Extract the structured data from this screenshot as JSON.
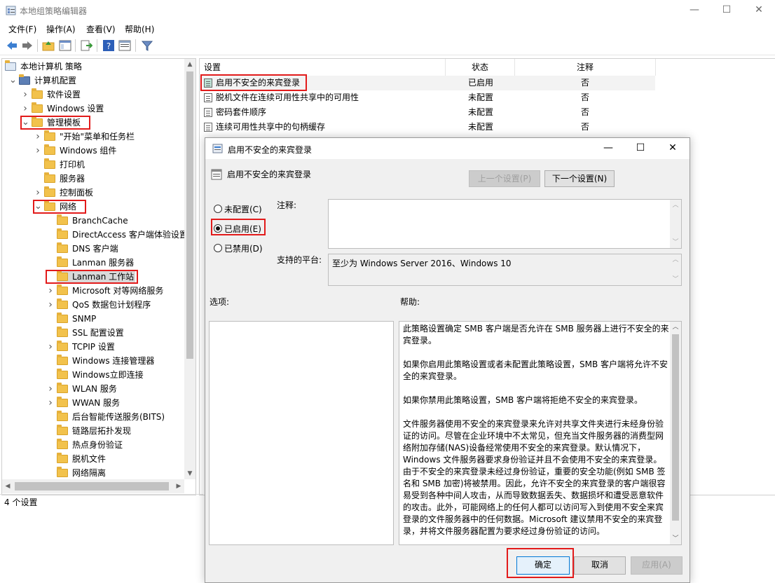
{
  "window": {
    "title": "本地组策略编辑器",
    "menu": [
      "文件(F)",
      "操作(A)",
      "查看(V)",
      "帮助(H)"
    ]
  },
  "tree": {
    "items": [
      {
        "label": "本地计算机 策略",
        "level": 0,
        "toggle": ""
      },
      {
        "label": "计算机配置",
        "level": 1,
        "toggle": "open"
      },
      {
        "label": "软件设置",
        "level": 2,
        "toggle": "closed"
      },
      {
        "label": "Windows 设置",
        "level": 2,
        "toggle": "closed"
      },
      {
        "label": "管理模板",
        "level": 2,
        "toggle": "open",
        "highlight": true
      },
      {
        "label": "\"开始\"菜单和任务栏",
        "level": 3,
        "toggle": "closed"
      },
      {
        "label": "Windows 组件",
        "level": 3,
        "toggle": "closed"
      },
      {
        "label": "打印机",
        "level": 3,
        "toggle": ""
      },
      {
        "label": "服务器",
        "level": 3,
        "toggle": ""
      },
      {
        "label": "控制面板",
        "level": 3,
        "toggle": "closed"
      },
      {
        "label": "网络",
        "level": 3,
        "toggle": "open",
        "highlight": true
      },
      {
        "label": "BranchCache",
        "level": 4,
        "toggle": ""
      },
      {
        "label": "DirectAccess 客户端体验设置",
        "level": 4,
        "toggle": ""
      },
      {
        "label": "DNS 客户端",
        "level": 4,
        "toggle": ""
      },
      {
        "label": "Lanman 服务器",
        "level": 4,
        "toggle": ""
      },
      {
        "label": "Lanman 工作站",
        "level": 4,
        "toggle": "",
        "highlight": true,
        "selected": true
      },
      {
        "label": "Microsoft 对等网络服务",
        "level": 4,
        "toggle": "closed"
      },
      {
        "label": "QoS 数据包计划程序",
        "level": 4,
        "toggle": "closed"
      },
      {
        "label": "SNMP",
        "level": 4,
        "toggle": ""
      },
      {
        "label": "SSL 配置设置",
        "level": 4,
        "toggle": ""
      },
      {
        "label": "TCPIP 设置",
        "level": 4,
        "toggle": "closed"
      },
      {
        "label": "Windows 连接管理器",
        "level": 4,
        "toggle": ""
      },
      {
        "label": "Windows立即连接",
        "level": 4,
        "toggle": ""
      },
      {
        "label": "WLAN 服务",
        "level": 4,
        "toggle": "closed"
      },
      {
        "label": "WWAN 服务",
        "level": 4,
        "toggle": "closed"
      },
      {
        "label": "后台智能传送服务(BITS)",
        "level": 4,
        "toggle": ""
      },
      {
        "label": "链路层拓扑发现",
        "level": 4,
        "toggle": ""
      },
      {
        "label": "热点身份验证",
        "level": 4,
        "toggle": ""
      },
      {
        "label": "脱机文件",
        "level": 4,
        "toggle": ""
      },
      {
        "label": "网络隔离",
        "level": 4,
        "toggle": ""
      }
    ]
  },
  "list": {
    "columns": [
      "设置",
      "状态",
      "注释"
    ],
    "rows": [
      {
        "name": "启用不安全的来宾登录",
        "state": "已启用",
        "note": "否",
        "highlight": true
      },
      {
        "name": "脱机文件在连续可用性共享中的可用性",
        "state": "未配置",
        "note": "否"
      },
      {
        "name": "密码套件顺序",
        "state": "未配置",
        "note": "否"
      },
      {
        "name": "连续可用性共享中的句柄缓存",
        "state": "未配置",
        "note": "否"
      }
    ]
  },
  "status": "4 个设置",
  "dialog": {
    "title": "启用不安全的来宾登录",
    "header": "启用不安全的来宾登录",
    "prev_button": "上一个设置(P)",
    "next_button": "下一个设置(N)",
    "radios": [
      {
        "label": "未配置(C)",
        "checked": false
      },
      {
        "label": "已启用(E)",
        "checked": true
      },
      {
        "label": "已禁用(D)",
        "checked": false
      }
    ],
    "comment_label": "注释:",
    "platform_label": "支持的平台:",
    "platform_value": "至少为 Windows Server 2016、Windows 10",
    "options_label": "选项:",
    "help_label": "帮助:",
    "help_paragraphs": [
      "此策略设置确定 SMB 客户端是否允许在 SMB 服务器上进行不安全的来宾登录。",
      "如果你启用此策略设置或者未配置此策略设置，SMB 客户端将允许不安全的来宾登录。",
      "如果你禁用此策略设置，SMB 客户端将拒绝不安全的来宾登录。",
      "文件服务器使用不安全的来宾登录来允许对共享文件夹进行未经身份验证的访问。尽管在企业环境中不太常见，但充当文件服务器的消费型网络附加存储(NAS)设备经常使用不安全的来宾登录。默认情况下，Windows 文件服务器要求身份验证并且不会使用不安全的来宾登录。由于不安全的来宾登录未经过身份验证，重要的安全功能(例如 SMB 签名和 SMB 加密)将被禁用。因此，允许不安全的来宾登录的客户端很容易受到各种中间人攻击，从而导致数据丢失、数据损坏和遭受恶意软件的攻击。此外，可能网络上的任何人都可以访问写入到使用不安全来宾登录的文件服务器中的任何数据。Microsoft 建议禁用不安全的来宾登录，并将文件服务器配置为要求经过身份验证的访问。"
    ],
    "ok_button": "确定",
    "cancel_button": "取消",
    "apply_button": "应用(A)"
  },
  "colors": {
    "highlight_box": "#e21b1b",
    "folder": "#f2c24c",
    "selected_row": "#d9d9d9"
  }
}
